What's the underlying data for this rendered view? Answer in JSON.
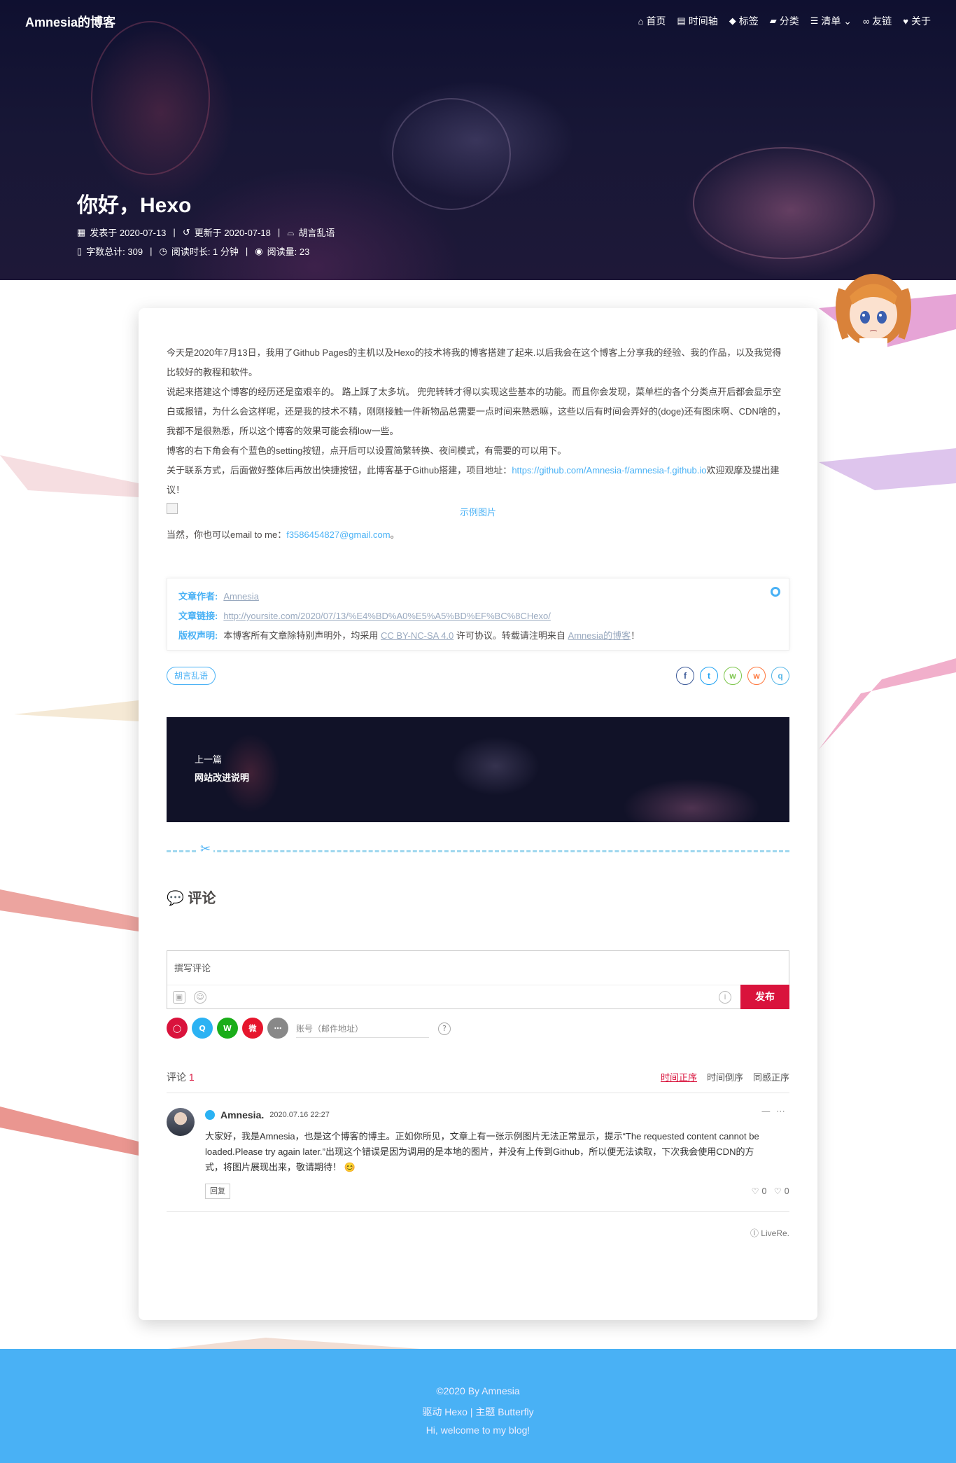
{
  "site": {
    "brand": "Amnesia的博客"
  },
  "nav": [
    {
      "icon": "home-icon",
      "glyph": "⌂",
      "label": "首页"
    },
    {
      "icon": "archive-icon",
      "glyph": "▤",
      "label": "时间轴"
    },
    {
      "icon": "tags-icon",
      "glyph": "◆",
      "label": "标签"
    },
    {
      "icon": "folder-icon",
      "glyph": "▰",
      "label": "分类"
    },
    {
      "icon": "list-icon",
      "glyph": "☰",
      "label": "清单 ⌄"
    },
    {
      "icon": "link-icon",
      "glyph": "∞",
      "label": "友链"
    },
    {
      "icon": "heart-icon",
      "glyph": "♥",
      "label": "关于"
    }
  ],
  "post": {
    "title": "你好，Hexo",
    "meta1": {
      "published": "发表于 2020-07-13",
      "updated": "更新于 2020-07-18",
      "category": "胡言乱语"
    },
    "meta2": {
      "words": "字数总计: 309",
      "read_time": "阅读时长: 1 分钟",
      "views": "阅读量: 23"
    },
    "paragraphs": [
      "今天是2020年7月13日，我用了Github Pages的主机以及Hexo的技术将我的博客搭建了起来.以后我会在这个博客上分享我的经验、我的作品，以及我觉得比较好的教程和软件。",
      "说起来搭建这个博客的经历还是蛮艰辛的。 路上踩了太多坑。 兜兜转转才得以实现这些基本的功能。而且你会发现，菜单栏的各个分类点开后都会显示空白或报错，为什么会这样呢，还是我的技术不精，刚刚接触一件新物品总需要一点时间来熟悉嘛，这些以后有时间会弄好的(doge)还有图床啊、CDN啥的，我都不是很熟悉，所以这个博客的效果可能会稍low一些。",
      "博客的右下角会有个蓝色的setting按钮，点开后可以设置简繁转换、夜间模式，有需要的可以用下。"
    ],
    "contact_prefix": "关于联系方式，后面做好整体后再放出快捷按钮，此博客基于Github搭建，项目地址：",
    "contact_link": "https://github.com/Amnesia-f/amnesia-f.github.io",
    "contact_suffix": "欢迎观摩及提出建议！",
    "image_caption": "示例图片",
    "email_prefix": "当然，你也可以email to me：",
    "email": "f3586454827@gmail.com",
    "email_suffix": "。"
  },
  "copyright": {
    "author_key": "文章作者:",
    "author_val": "Amnesia",
    "link_key": "文章链接:",
    "link_val": "http://yoursite.com/2020/07/13/%E4%BD%A0%E5%A5%BD%EF%BC%8CHexo/",
    "license_key": "版权声明:",
    "license_pre": "本博客所有文章除特别声明外，均采用",
    "license_link": "CC BY-NC-SA 4.0",
    "license_mid": "许可协议。转载请注明来自",
    "license_site": "Amnesia的博客",
    "license_end": "！"
  },
  "tag": "胡言乱语",
  "share": [
    {
      "icon": "facebook-icon",
      "glyph": "f",
      "color": "#3b5998"
    },
    {
      "icon": "twitter-icon",
      "glyph": "t",
      "color": "#1da1f2"
    },
    {
      "icon": "wechat-icon",
      "glyph": "w",
      "color": "#7bc549"
    },
    {
      "icon": "weibo-icon",
      "glyph": "w",
      "color": "#ff763b"
    },
    {
      "icon": "qq-icon",
      "glyph": "q",
      "color": "#56b6e7"
    }
  ],
  "prev_post": {
    "label": "上一篇",
    "title": "网站改进说明"
  },
  "comments": {
    "heading": "评论",
    "placeholder": "撰写评论",
    "post_button": "发布",
    "account_placeholder": "账号（邮件地址）",
    "count_label": "评论",
    "count": "1",
    "sorts": [
      "时间正序",
      "时间倒序",
      "同感正序"
    ],
    "items": [
      {
        "author": "Amnesia.",
        "time": "2020.07.16 22:27",
        "text": "大家好，我是Amnesia，也是这个博客的博主。正如你所见，文章上有一张示例图片无法正常显示，提示“The requested content cannot be loaded.Please try again later.”出现这个错误是因为调用的是本地的图片，并没有上传到Github，所以便无法读取，下次我会使用CDN的方式，将图片展现出来，敬请期待！ 😊",
        "reply": "回复",
        "likes": "0",
        "dislikes": "0"
      }
    ],
    "powered": "ⓛ LiveRe."
  },
  "login": [
    {
      "icon": "livere-icon",
      "color": "#d9133c"
    },
    {
      "icon": "qq-icon",
      "color": "#2bb2f3"
    },
    {
      "icon": "wechat-icon",
      "color": "#1aad19"
    },
    {
      "icon": "weibo-icon",
      "color": "#e6162d"
    },
    {
      "icon": "more-icon",
      "color": "#888888"
    }
  ],
  "footer": {
    "line1": "©2020 By Amnesia",
    "line2": "驱动 Hexo | 主题 Butterfly",
    "line3": "Hi, welcome to my blog!"
  }
}
